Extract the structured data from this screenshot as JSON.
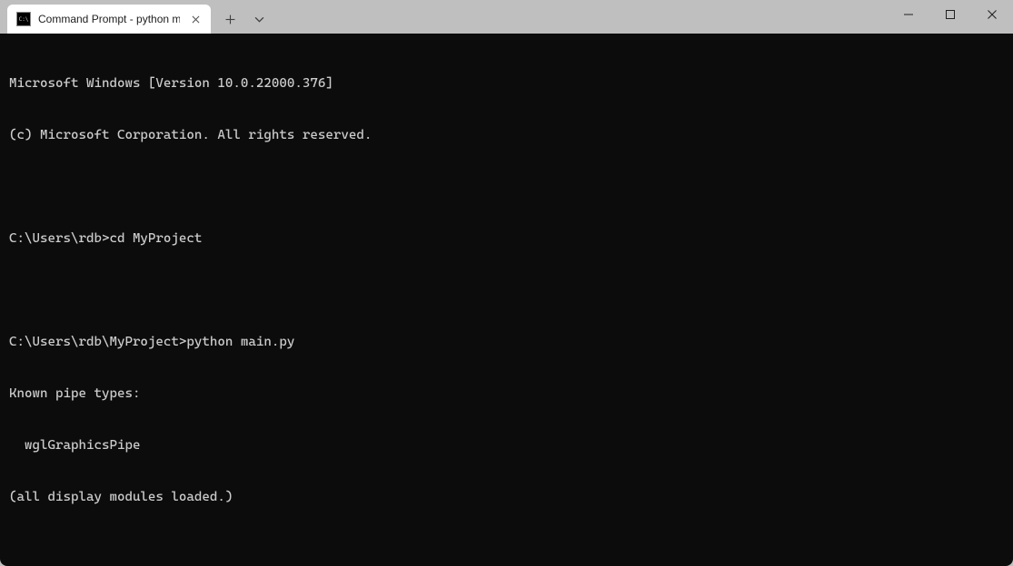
{
  "window": {
    "tab_title": "Command Prompt - python  ma"
  },
  "terminal": {
    "lines": [
      "Microsoft Windows [Version 10.0.22000.376]",
      "(c) Microsoft Corporation. All rights reserved.",
      "",
      "C:\\Users\\rdb>cd MyProject",
      "",
      "C:\\Users\\rdb\\MyProject>python main.py",
      "Known pipe types:",
      "  wglGraphicsPipe",
      "(all display modules loaded.)"
    ]
  }
}
